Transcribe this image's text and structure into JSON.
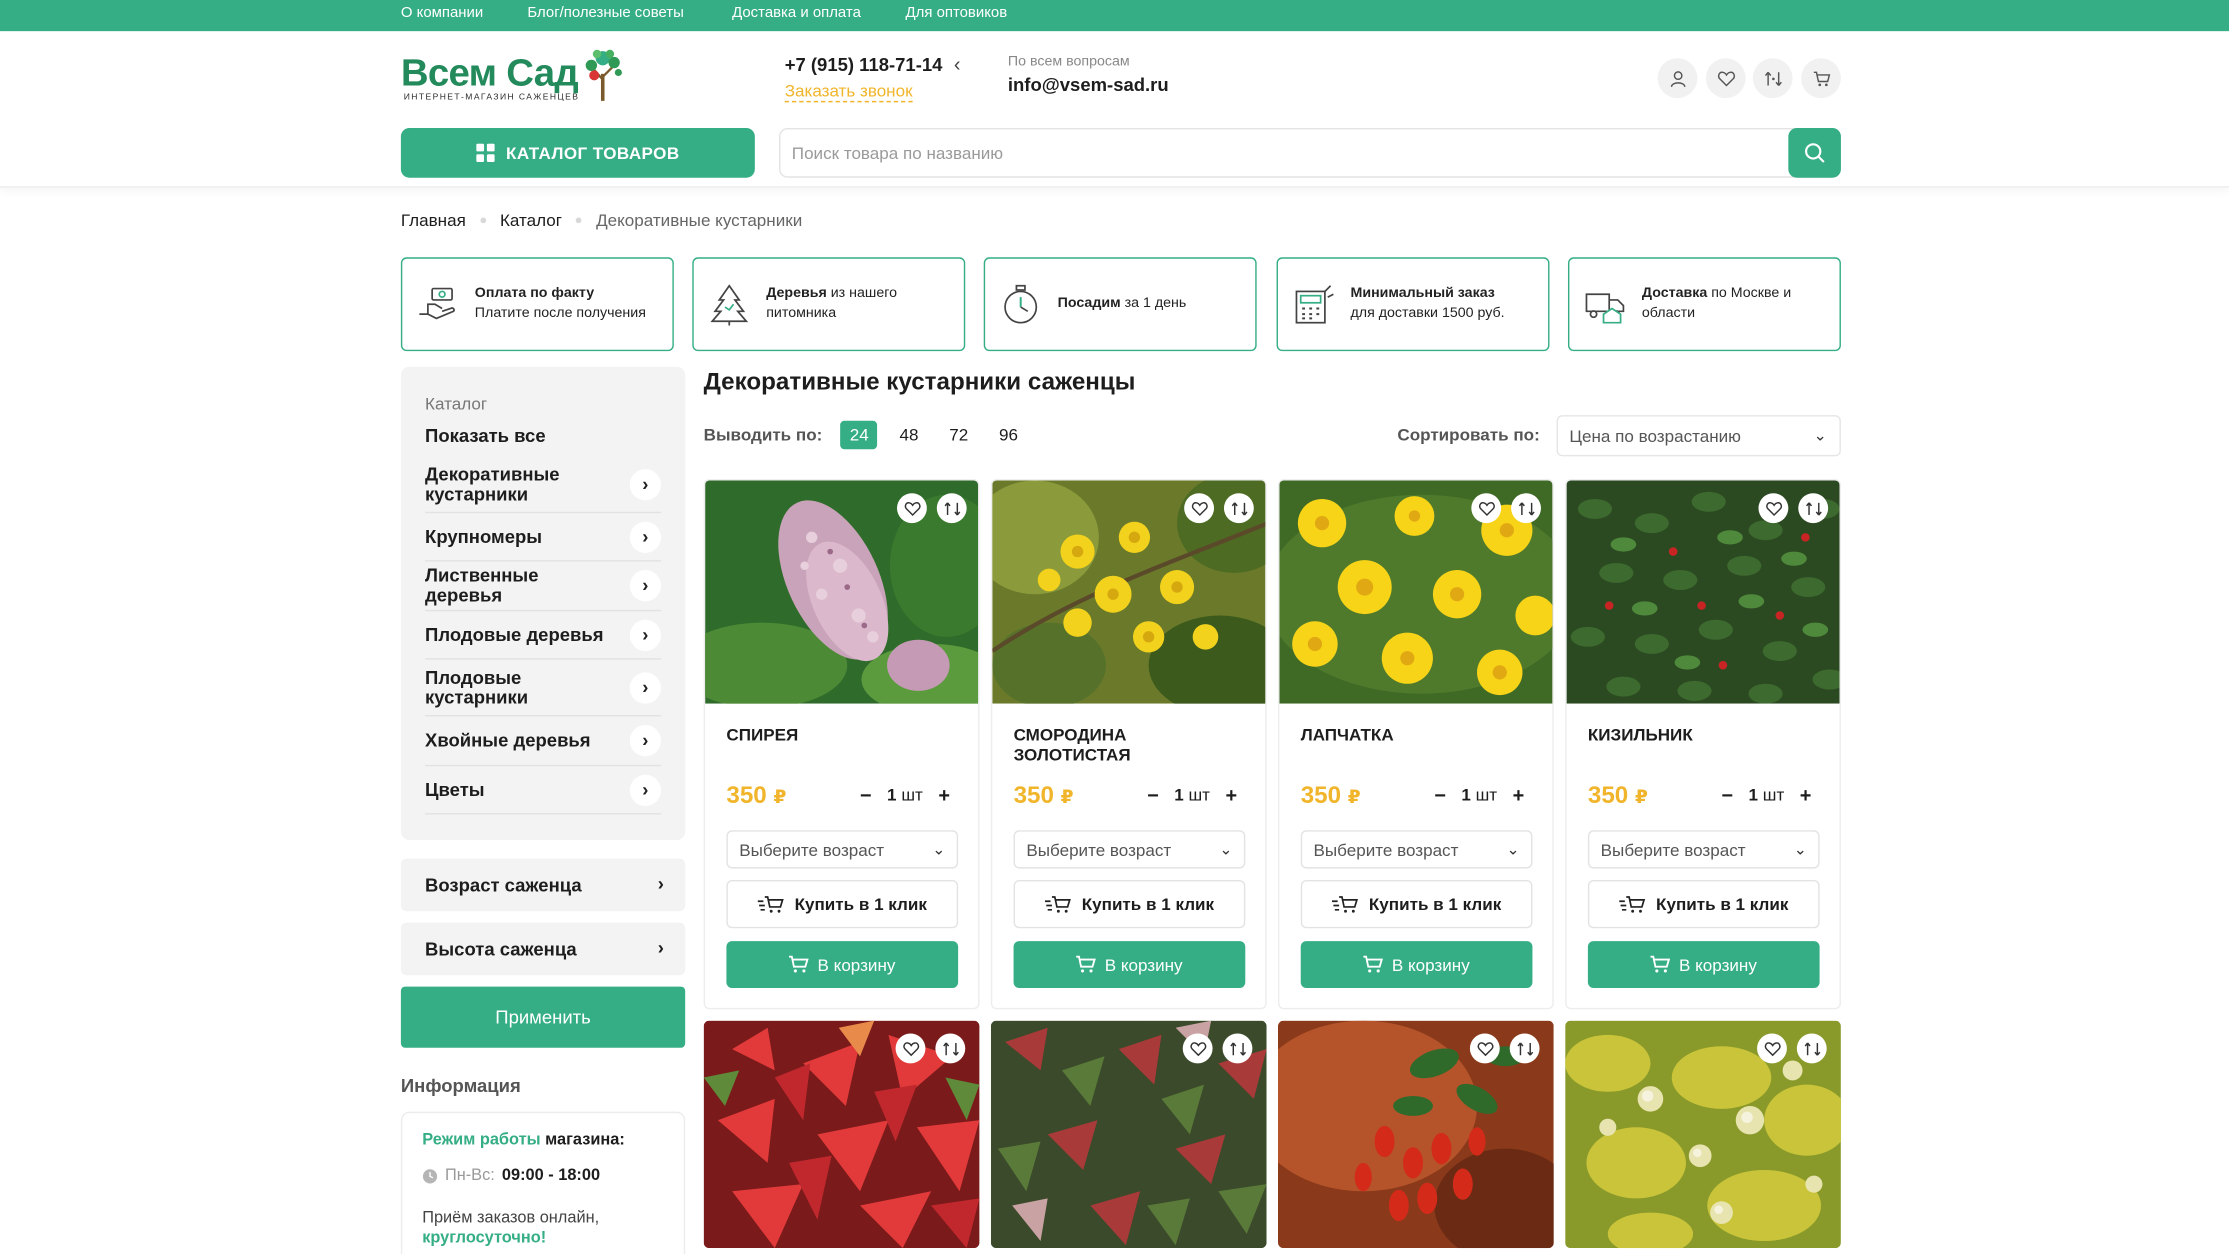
{
  "topbar": {
    "links": [
      "О компании",
      "Блог/полезные советы",
      "Доставка и оплата",
      "Для оптовиков"
    ]
  },
  "header": {
    "logo_text": "Всем Сад",
    "logo_sub": "ИНТЕРНЕТ-МАГАЗИН САЖЕНЦЕВ",
    "phone": "+7 (915) 118-71-14",
    "callback": "Заказать звонок",
    "questions_label": "По всем вопросам",
    "email": "info@vsem-sad.ru",
    "catalog_button": "КАТАЛОГ ТОВАРОВ",
    "search_placeholder": "Поиск товара по названию"
  },
  "breadcrumb": [
    "Главная",
    "Каталог",
    "Декоративные кустарники"
  ],
  "features": [
    {
      "bold": "Оплата по факту",
      "text": "Платите после получения",
      "icon": "hand-money-icon"
    },
    {
      "bold": "Деревья",
      "text": "из нашего питомника",
      "icon": "tree-icon"
    },
    {
      "bold": "Посадим",
      "text": "за 1 день",
      "icon": "timer-icon"
    },
    {
      "bold": "Минимальный заказ",
      "text": "для доставки 1500 руб.",
      "icon": "calculator-icon"
    },
    {
      "bold": "Доставка",
      "text": "по Москве и области",
      "icon": "truck-icon"
    }
  ],
  "sidebar": {
    "caption": "Каталог",
    "show_all": "Показать все",
    "items": [
      "Декоративные кустарники",
      "Крупномеры",
      "Лиственные деревья",
      "Плодовые деревья",
      "Плодовые кустарники",
      "Хвойные деревья",
      "Цветы"
    ],
    "filters": [
      "Возраст саженца",
      "Высота саженца"
    ],
    "apply": "Применить",
    "info_heading": "Информация",
    "hours_label_green": "Режим работы",
    "hours_label_rest": "магазина:",
    "days": "Пн-Вс:",
    "hours": "09:00 - 18:00",
    "online_text": "Приём заказов онлайн,",
    "online_green": "круглосуточно!"
  },
  "main": {
    "title": "Декоративные кустарники саженцы",
    "per_page_label": "Выводить по:",
    "per_page_options": [
      "24",
      "48",
      "72",
      "96"
    ],
    "per_page_selected": "24",
    "sort_label": "Сортировать по:",
    "sort_value": "Цена по возрастанию"
  },
  "products": [
    {
      "name": "Спирея",
      "price": "350",
      "currency": "₽",
      "qty": "1",
      "unit": "шт",
      "age_placeholder": "Выберите возраст",
      "one_click": "Купить в 1 клик",
      "cart": "В корзину"
    },
    {
      "name": "Смородина золотистая",
      "price": "350",
      "currency": "₽",
      "qty": "1",
      "unit": "шт",
      "age_placeholder": "Выберите возраст",
      "one_click": "Купить в 1 клик",
      "cart": "В корзину"
    },
    {
      "name": "Лапчатка",
      "price": "350",
      "currency": "₽",
      "qty": "1",
      "unit": "шт",
      "age_placeholder": "Выберите возраст",
      "one_click": "Купить в 1 клик",
      "cart": "В корзину"
    },
    {
      "name": "Кизильник",
      "price": "350",
      "currency": "₽",
      "qty": "1",
      "unit": "шт",
      "age_placeholder": "Выберите возраст",
      "one_click": "Купить в 1 клик",
      "cart": "В корзину"
    }
  ],
  "colors": {
    "accent": "#35ae85",
    "price": "#f1b52b",
    "logo": "#238a5c"
  }
}
